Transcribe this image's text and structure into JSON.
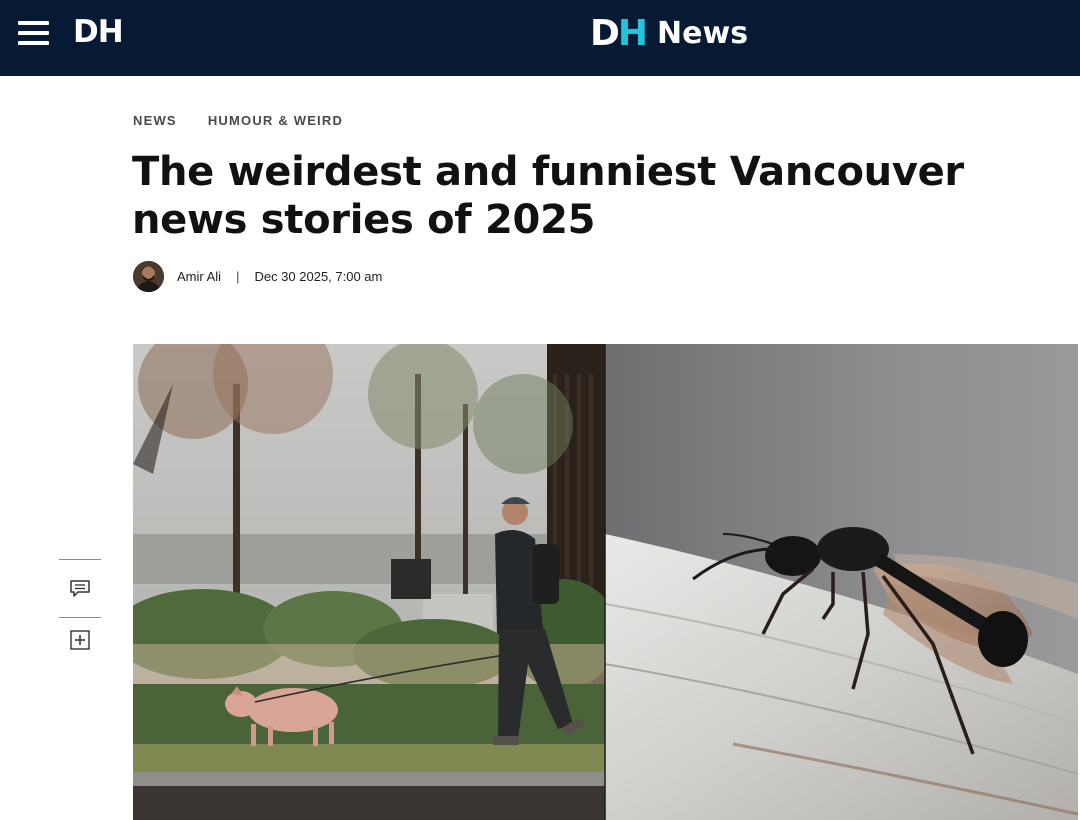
{
  "header": {
    "menu_icon": "hamburger-menu-icon",
    "logo_small": "DH",
    "brand": {
      "d": "D",
      "h": "H",
      "news": "News"
    },
    "colors": {
      "bar": "#061a33",
      "accent": "#21c4d8"
    }
  },
  "breadcrumbs": [
    "NEWS",
    "HUMOUR & WEIRD"
  ],
  "article": {
    "title": "The weirdest and funniest Vancouver news stories of 2025",
    "author": "Amir Ali",
    "separator": "|",
    "date": "Dec 30 2025, 7:00 am"
  },
  "tools": [
    {
      "icon": "comment-icon"
    },
    {
      "icon": "add-icon"
    }
  ],
  "hero": {
    "left_image": "man-walking-pig-on-leash",
    "right_image": "winged-carpenter-ant-closeup"
  }
}
